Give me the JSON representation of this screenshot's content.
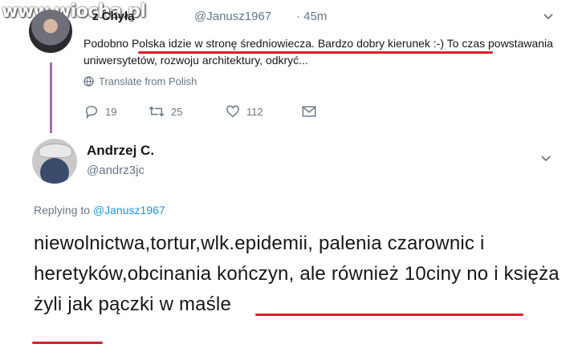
{
  "watermark": "www.wiocha.pl",
  "tweet1": {
    "name": "z Chyła",
    "handle": "@Janusz1967",
    "time": "· 45m",
    "text": "Podobno Polska idzie w stronę średniowiecza. Bardzo dobry kierunek :-) To czas powstawania uniwersytetów, rozwoju architektury, odkryć...",
    "translate": "Translate from Polish",
    "reply_count": "19",
    "retweet_count": "25",
    "like_count": "112"
  },
  "tweet2": {
    "name": "Andrzej C.",
    "handle": "@andrz3jc",
    "replying_prefix": "Replying to",
    "replying_to": "@Janusz1967",
    "text": "niewolnictwa,tortur,wlk.epidemii, palenia czarownic i heretyków,obcinania kończyn, ale również 10ciny no i księża żyli jak pączki w maśle"
  },
  "colors": {
    "accent": "#1b95e0",
    "highlight_underline": "#d6202a",
    "thread_line": "#a86ab8",
    "muted_text": "#657786"
  },
  "icons": [
    "globe-icon",
    "reply-icon",
    "retweet-icon",
    "heart-icon",
    "message-icon",
    "chevron-down-icon"
  ]
}
